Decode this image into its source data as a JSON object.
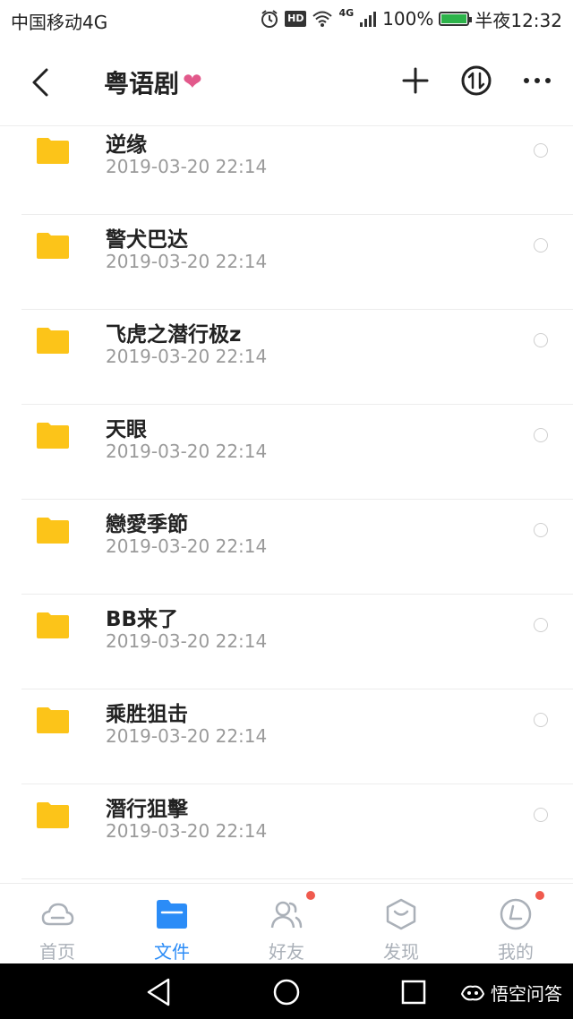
{
  "status_bar": {
    "carrier": "中国移动4G",
    "hd_badge": "HD",
    "network": "4G",
    "battery": "100%",
    "time": "半夜12:32"
  },
  "header": {
    "title": "粤语剧",
    "heart": "❤"
  },
  "files": [
    {
      "name": "逆缘",
      "date": "2019-03-20  22:14"
    },
    {
      "name": "警犬巴达",
      "date": "2019-03-20  22:14"
    },
    {
      "name": "飞虎之潜行极z",
      "date": "2019-03-20  22:14"
    },
    {
      "name": "天眼",
      "date": "2019-03-20  22:14"
    },
    {
      "name": "戀愛季節",
      "date": "2019-03-20  22:14"
    },
    {
      "name": "BB来了",
      "date": "2019-03-20  22:14"
    },
    {
      "name": "乘胜狙击",
      "date": "2019-03-20  22:14"
    },
    {
      "name": "潛行狙擊",
      "date": "2019-03-20  22:14"
    }
  ],
  "tabs": [
    {
      "label": "首页",
      "icon": "cloud-icon"
    },
    {
      "label": "文件",
      "icon": "folder-icon"
    },
    {
      "label": "好友",
      "icon": "friends-icon"
    },
    {
      "label": "发现",
      "icon": "discover-icon"
    },
    {
      "label": "我的",
      "icon": "profile-icon"
    }
  ],
  "watermark": "悟空问答",
  "colors": {
    "accent": "#2b8cf7",
    "folder": "#fcc419",
    "badge": "#f05a4e"
  }
}
